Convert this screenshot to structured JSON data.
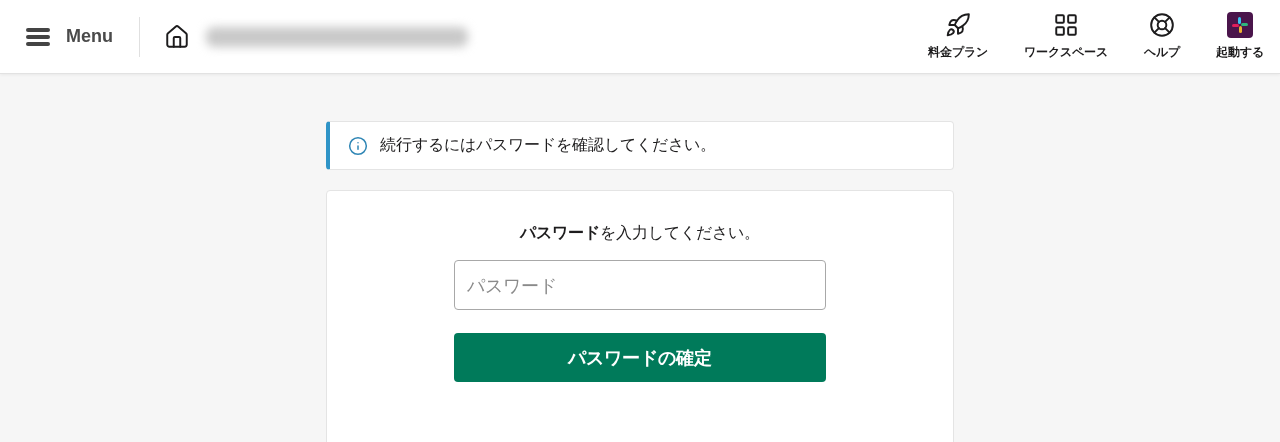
{
  "header": {
    "menu_label": "Menu",
    "nav": [
      {
        "kind": "rocket",
        "label": "料金プラン"
      },
      {
        "kind": "grid",
        "label": "ワークスペース"
      },
      {
        "kind": "help",
        "label": "ヘルプ"
      },
      {
        "kind": "app",
        "label": "起動する"
      }
    ]
  },
  "notice": {
    "text": "続行するにはパスワードを確認してください。"
  },
  "form": {
    "prompt": "**パスワード**を入力してください。",
    "password": {
      "placeholder": "パスワード"
    },
    "submit": "パスワードの確定"
  }
}
